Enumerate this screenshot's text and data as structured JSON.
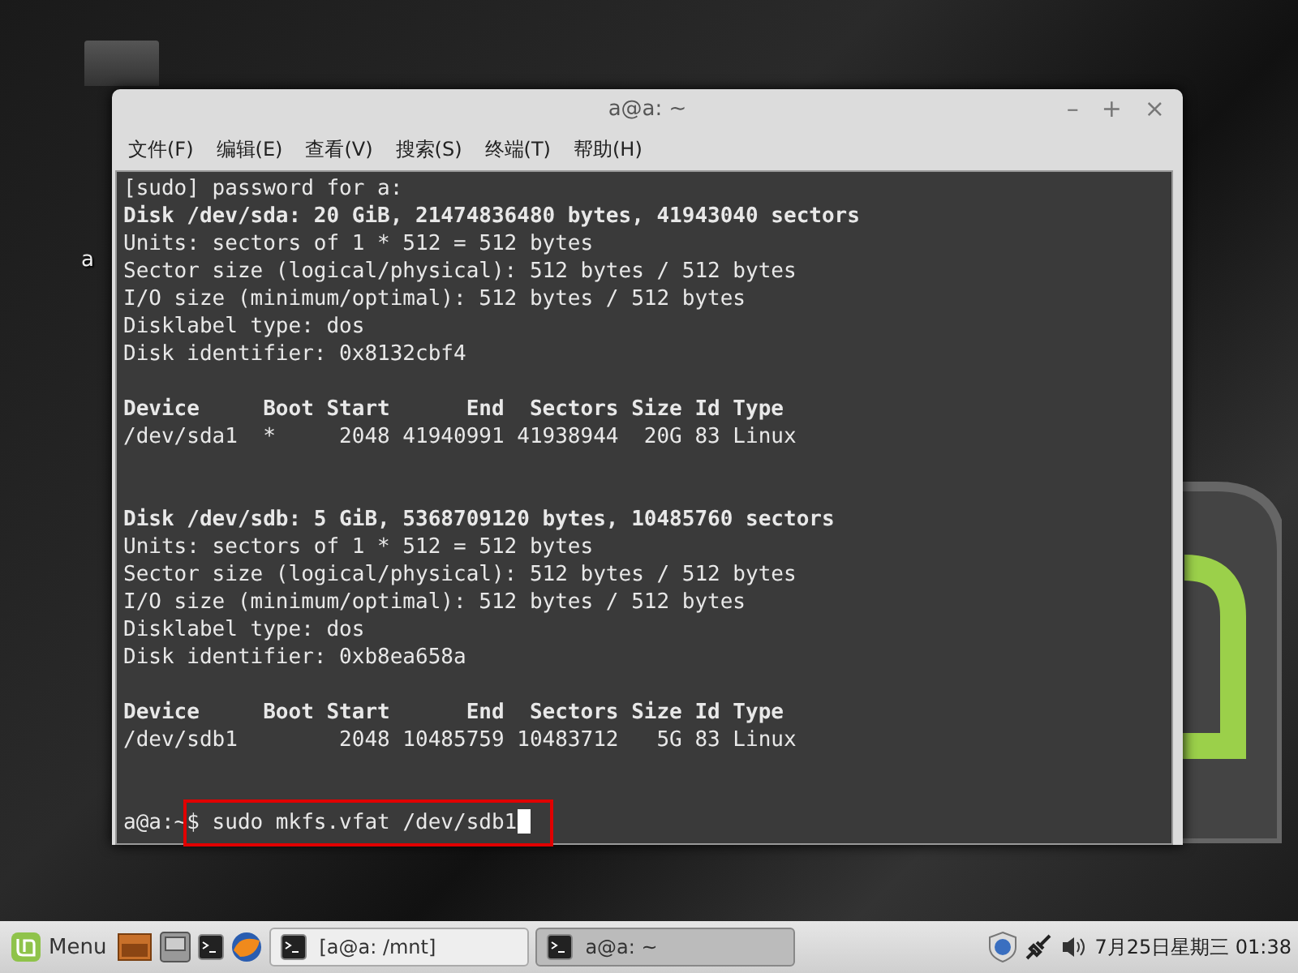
{
  "desktop": {
    "icons": [
      {
        "label": "a"
      }
    ]
  },
  "window": {
    "title": "a@a: ~",
    "controls": [
      "–",
      "+",
      "×"
    ],
    "menu": [
      "文件(F)",
      "编辑(E)",
      "查看(V)",
      "搜索(S)",
      "终端(T)",
      "帮助(H)"
    ],
    "terminal": {
      "lines": [
        {
          "kind": "normal",
          "text": "[sudo] password for a:"
        },
        {
          "kind": "bold",
          "text": "Disk /dev/sda: 20 GiB, 21474836480 bytes, 41943040 sectors"
        },
        {
          "kind": "normal",
          "text": "Units: sectors of 1 * 512 = 512 bytes"
        },
        {
          "kind": "normal",
          "text": "Sector size (logical/physical): 512 bytes / 512 bytes"
        },
        {
          "kind": "normal",
          "text": "I/O size (minimum/optimal): 512 bytes / 512 bytes"
        },
        {
          "kind": "normal",
          "text": "Disklabel type: dos"
        },
        {
          "kind": "normal",
          "text": "Disk identifier: 0x8132cbf4"
        },
        {
          "kind": "blank"
        },
        {
          "kind": "bold",
          "text": "Device     Boot Start      End  Sectors Size Id Type"
        },
        {
          "kind": "normal",
          "text": "/dev/sda1  *     2048 41940991 41938944  20G 83 Linux"
        },
        {
          "kind": "blank"
        },
        {
          "kind": "blank"
        },
        {
          "kind": "bold",
          "text": "Disk /dev/sdb: 5 GiB, 5368709120 bytes, 10485760 sectors"
        },
        {
          "kind": "normal",
          "text": "Units: sectors of 1 * 512 = 512 bytes"
        },
        {
          "kind": "normal",
          "text": "Sector size (logical/physical): 512 bytes / 512 bytes"
        },
        {
          "kind": "normal",
          "text": "I/O size (minimum/optimal): 512 bytes / 512 bytes"
        },
        {
          "kind": "normal",
          "text": "Disklabel type: dos"
        },
        {
          "kind": "normal",
          "text": "Disk identifier: 0xb8ea658a"
        },
        {
          "kind": "blank"
        },
        {
          "kind": "bold",
          "text": "Device     Boot Start      End  Sectors Size Id Type"
        },
        {
          "kind": "normal",
          "text": "/dev/sdb1        2048 10485759 10483712   5G 83 Linux"
        },
        {
          "kind": "blank"
        },
        {
          "kind": "blank"
        },
        {
          "kind": "prompt",
          "prompt": "a@a:~",
          "text": "$ sudo mkfs.vfat /dev/sdb1"
        }
      ]
    }
  },
  "taskbar": {
    "menu_label": "Menu",
    "tasks": [
      {
        "label": "[a@a: /mnt]",
        "selected": false
      },
      {
        "label": "a@a: ~",
        "selected": true
      }
    ],
    "clock": "7月25日星期三 01:38"
  }
}
